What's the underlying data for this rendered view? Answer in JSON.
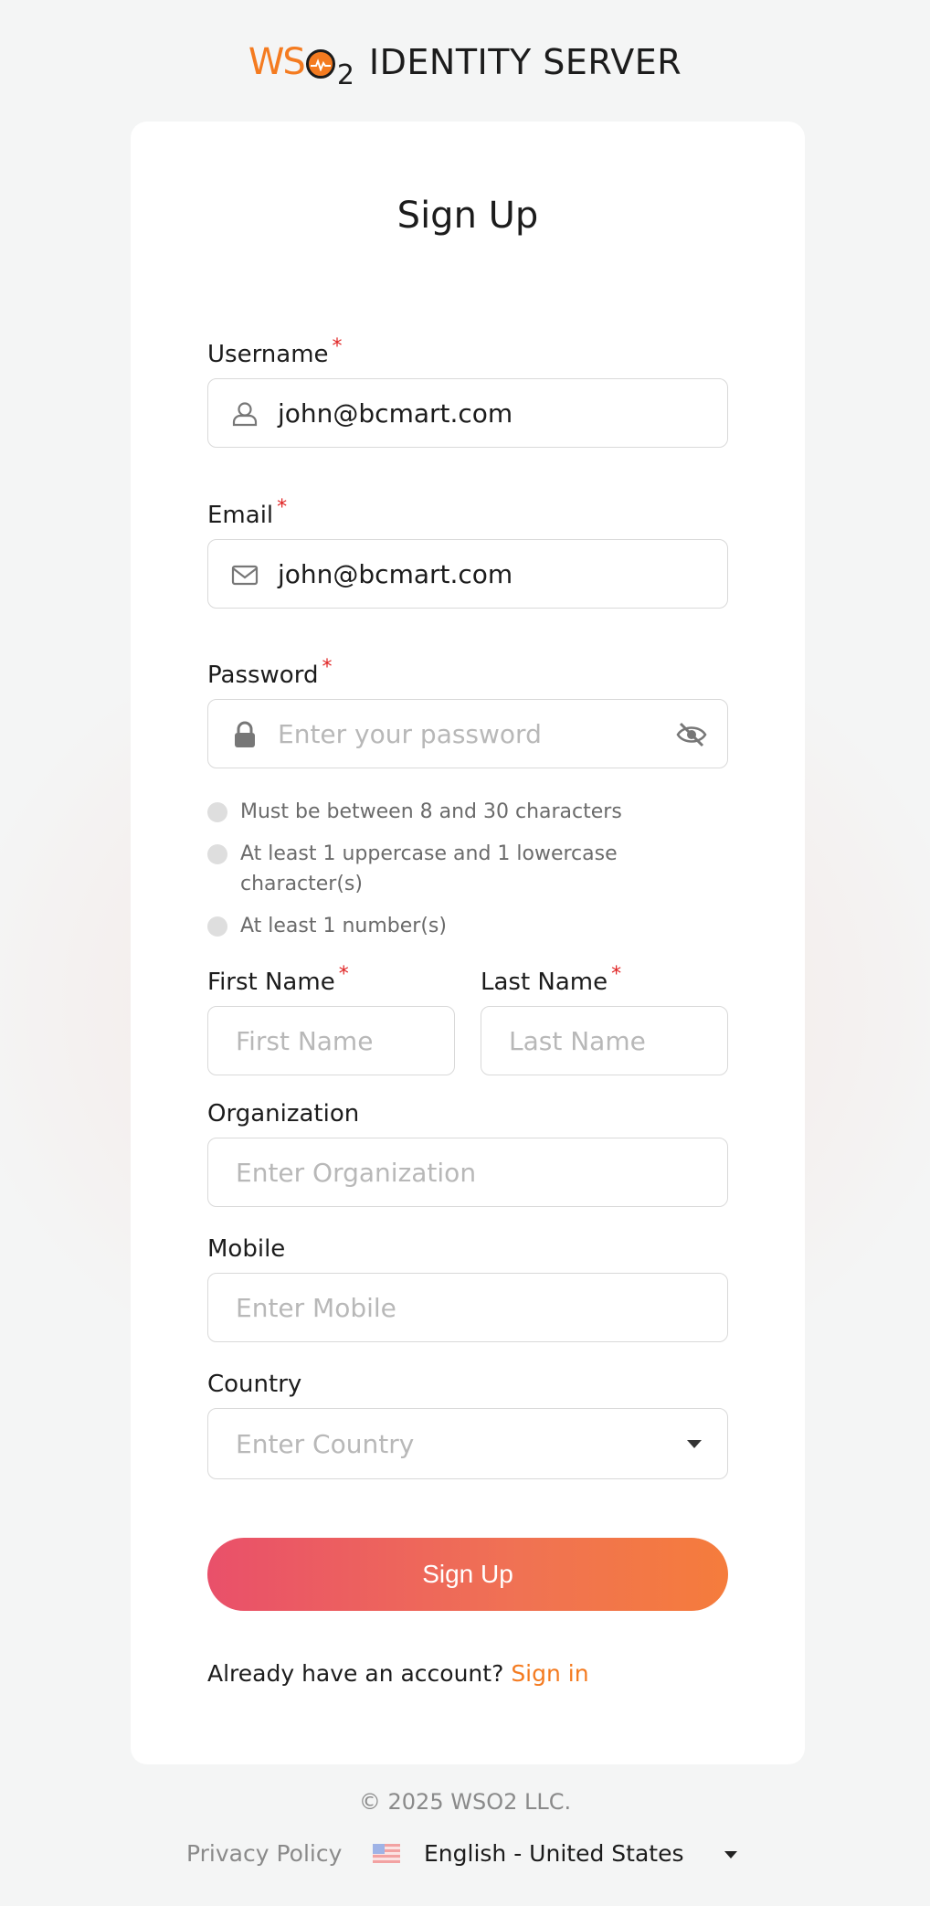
{
  "brand": {
    "logo_ws": "WS",
    "logo_2": "2",
    "product_name": "IDENTITY SERVER",
    "accent_color": "#f47b20"
  },
  "form": {
    "title": "Sign Up",
    "username": {
      "label": "Username",
      "required_mark": "*",
      "value": "john@bcmart.com",
      "icon": "user-icon"
    },
    "email": {
      "label": "Email",
      "required_mark": "*",
      "value": "john@bcmart.com",
      "icon": "mail-icon"
    },
    "password": {
      "label": "Password",
      "required_mark": "*",
      "placeholder": "Enter your password",
      "icon": "lock-icon",
      "toggle_icon": "eye-slash-icon"
    },
    "password_rules": [
      "Must be between 8 and 30 characters",
      "At least 1 uppercase and 1 lowercase character(s)",
      "At least 1 number(s)"
    ],
    "first_name": {
      "label": "First Name",
      "required_mark": "*",
      "placeholder": "First Name"
    },
    "last_name": {
      "label": "Last Name",
      "required_mark": "*",
      "placeholder": "Last Name"
    },
    "organization": {
      "label": "Organization",
      "placeholder": "Enter Organization"
    },
    "mobile": {
      "label": "Mobile",
      "placeholder": "Enter Mobile"
    },
    "country": {
      "label": "Country",
      "placeholder": "Enter Country"
    },
    "submit_label": "Sign Up",
    "signin_prompt": "Already have an account?",
    "signin_link": "Sign in"
  },
  "footer": {
    "copyright": "© 2025 WSO2 LLC.",
    "privacy_policy": "Privacy Policy",
    "language": "English - United States"
  }
}
